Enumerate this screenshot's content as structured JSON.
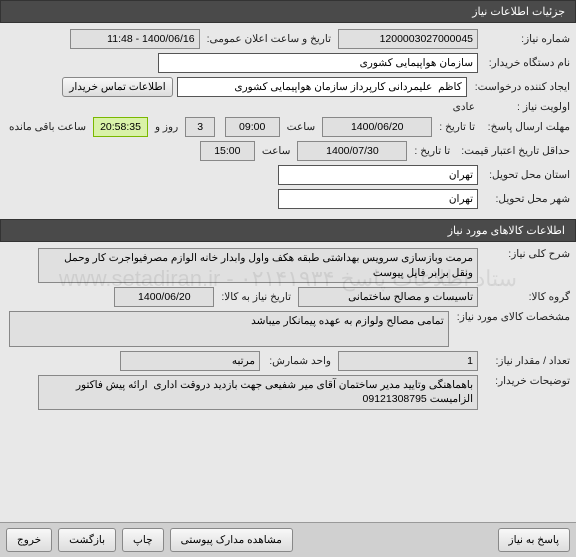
{
  "watermark": "ستاد اطلاعات پاسخ ۰۲۱۴۱۹۳۴ - www.setadiran.ir",
  "sections": {
    "need_details": {
      "title": "جزئیات اطلاعات نیاز"
    },
    "goods_info": {
      "title": "اطلاعات کالاهای مورد نیاز"
    }
  },
  "labels": {
    "need_number": "شماره نیاز:",
    "announce_datetime": "تاریخ و ساعت اعلان عمومی:",
    "buyer_org": "نام دستگاه خریدار:",
    "requester": "ایجاد کننده درخواست:",
    "contact_info": "اطلاعات تماس خریدار",
    "priority": "اولویت نیاز :",
    "priority_value": "عادی",
    "response_deadline": "مهلت ارسال پاسخ:",
    "to_date": "تا تاریخ :",
    "time": "ساعت",
    "days_and": "روز و",
    "time_remaining": "ساعت باقی مانده",
    "price_validity": "حداقل تاریخ اعتبار قیمت:",
    "delivery_province": "استان محل تحویل:",
    "delivery_city": "شهر محل تحویل:",
    "goods_desc": "شرح کلی نیاز:",
    "goods_group": "گروه کالا:",
    "need_by_date": "تاریخ نیاز به کالا:",
    "goods_spec": "مشخصات کالای مورد نیاز:",
    "qty": "تعداد / مقدار نیاز:",
    "unit": "واحد شمارش:",
    "buyer_notes": "توضیحات خریدار:"
  },
  "values": {
    "need_number": "1200003027000045",
    "announce_datetime": "1400/06/16 - 11:48",
    "buyer_org": "سازمان هواپیمایی کشوری",
    "requester": "کاظم  علیمردانی کارپرداز سازمان هواپیمایی کشوری",
    "response_deadline_date": "1400/06/20",
    "response_deadline_time": "09:00",
    "days_remaining": "3",
    "countdown": "20:58:35",
    "price_validity_date": "1400/07/30",
    "price_validity_time": "15:00",
    "delivery_province": "تهران",
    "delivery_city": "تهران",
    "goods_desc": "مرمت وبازسازی سرویس بهداشتی طبقه هکف واول وابدار خانه الوازم مصرفیواجرت کار وحمل ونقل برابر فایل پیوست",
    "goods_group": "تاسیسات و مصالح ساختمانی",
    "need_by_date": "1400/06/20",
    "goods_spec": "تمامی مصالح ولوازم به عهده پیمانکار میباشد",
    "qty": "1",
    "unit": "مرتبه",
    "buyer_notes": "باهماهنگی وتایید مدیر ساختمان آقای میر شفیعی جهت بازدید دروقت اداری  ارائه پیش فاکتور الزامیست 09121308795"
  },
  "footer": {
    "respond": "پاسخ به نیاز",
    "attachments": "مشاهده مدارک پیوستی",
    "print": "چاپ",
    "back": "بازگشت",
    "exit": "خروج"
  }
}
